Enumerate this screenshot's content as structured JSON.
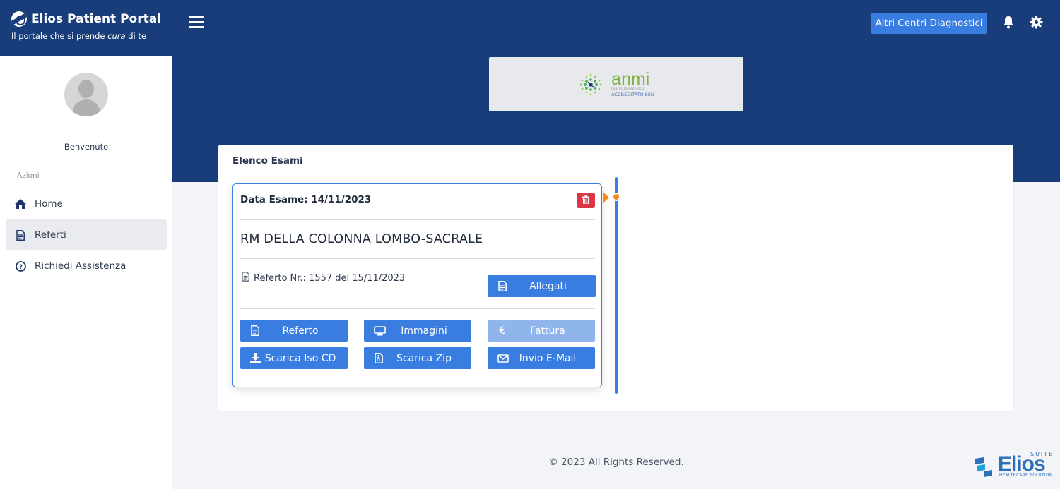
{
  "brand": {
    "title": "Elios Patient Portal",
    "subtitle_pre": "Il portale che si prende ",
    "subtitle_em": "cura",
    "subtitle_post": " di te"
  },
  "sidebar": {
    "welcome": "Benvenuto",
    "section_label": "Azioni",
    "items": [
      {
        "label": "Home",
        "icon": "home-icon",
        "active": false
      },
      {
        "label": "Referti",
        "icon": "document-icon",
        "active": true
      },
      {
        "label": "Richiedi Assistenza",
        "icon": "help-circle-icon",
        "active": false
      }
    ]
  },
  "header": {
    "altri_label": "Altri Centri Diagnostici"
  },
  "center_logo": {
    "word": "anmi",
    "small": "CENTRO DIAGNOSTICO",
    "ssn": "ACCREDITATO SSN"
  },
  "main": {
    "title": "Elenco Esami",
    "exam": {
      "date": "Data Esame: 14/11/2023",
      "name": "RM DELLA COLONNA LOMBO-SACRALE",
      "referto_info": "Referto Nr.: 1557 del 15/11/2023",
      "buttons": {
        "allegati": "Allegati",
        "referto": "Referto",
        "immagini": "Immagini",
        "fattura": "Fattura",
        "scarica_iso": "Scarica Iso CD",
        "scarica_zip": "Scarica Zip",
        "invio_email": "Invio E-Mail"
      }
    }
  },
  "footer": {
    "copyright": "© 2023 All Rights Reserved.",
    "elios_word": "Elios",
    "elios_suite": "SUITE",
    "elios_tag": "HEALTHCARE SOLUTION"
  },
  "colors": {
    "navy": "#183d7a",
    "primary": "#3a7de0",
    "danger": "#dc3545",
    "accent_orange": "#f38b1c"
  }
}
